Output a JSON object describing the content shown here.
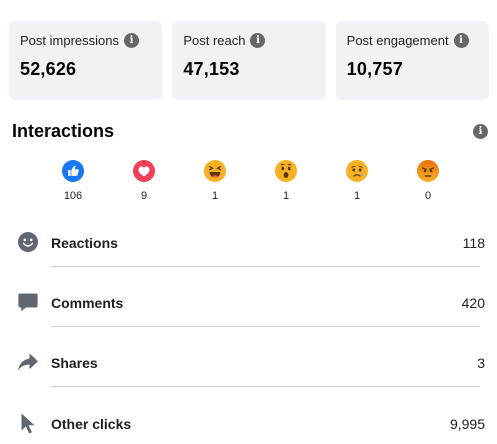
{
  "cards": [
    {
      "label": "Post impressions",
      "value": "52,626"
    },
    {
      "label": "Post reach",
      "value": "47,153"
    },
    {
      "label": "Post engagement",
      "value": "10,757"
    }
  ],
  "info_glyph": "i",
  "interactions": {
    "title": "Interactions",
    "reactions": [
      {
        "name": "like-icon",
        "count": "106"
      },
      {
        "name": "love-icon",
        "count": "9"
      },
      {
        "name": "haha-icon",
        "count": "1"
      },
      {
        "name": "wow-icon",
        "count": "1"
      },
      {
        "name": "sad-icon",
        "count": "1"
      },
      {
        "name": "angry-icon",
        "count": "0"
      }
    ],
    "rows": [
      {
        "icon": "smiley-icon",
        "label": "Reactions",
        "value": "118"
      },
      {
        "icon": "comment-icon",
        "label": "Comments",
        "value": "420"
      },
      {
        "icon": "share-icon",
        "label": "Shares",
        "value": "3"
      },
      {
        "icon": "cursor-icon",
        "label": "Other clicks",
        "value": "9,995"
      }
    ]
  },
  "colors": {
    "like_blue": "#1877f2",
    "love_red": "#f33e58",
    "emoji_yellow": "#f7b125",
    "angry_top": "#e9710f",
    "icon_gray": "#606770"
  }
}
